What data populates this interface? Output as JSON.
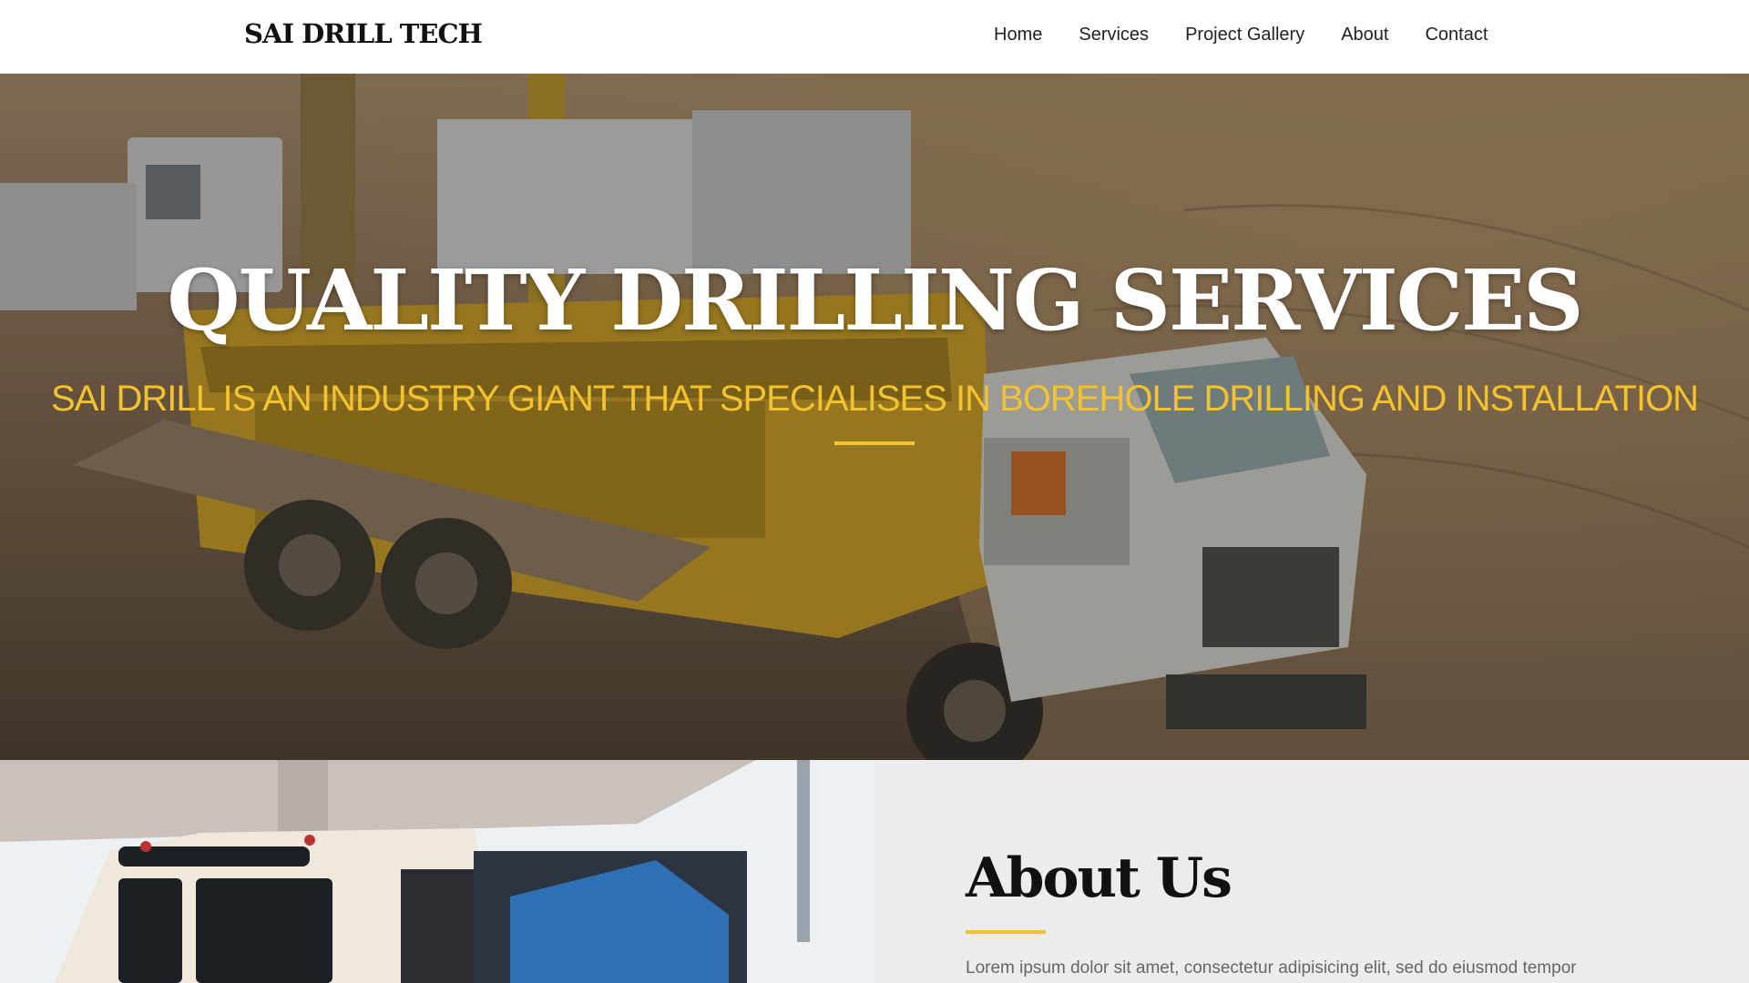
{
  "header": {
    "logo": "SAI DRILL TECH",
    "nav": [
      {
        "label": "Home"
      },
      {
        "label": "Services"
      },
      {
        "label": "Project Gallery"
      },
      {
        "label": "About"
      },
      {
        "label": "Contact"
      }
    ]
  },
  "hero": {
    "title": "QUALITY DRILLING SERVICES",
    "subtitle": "SAI DRILL IS AN INDUSTRY GIANT THAT SPECIALISES IN BOREHOLE DRILLING AND INSTALLATION"
  },
  "about": {
    "heading": "About Us",
    "text": "Lorem ipsum dolor sit amet, consectetur adipisicing elit, sed do eiusmod tempor"
  },
  "colors": {
    "accent": "#f2c230",
    "header_bg": "#ffffff",
    "about_bg": "#ececec",
    "text_dark": "#111111",
    "text_muted": "#666666"
  }
}
